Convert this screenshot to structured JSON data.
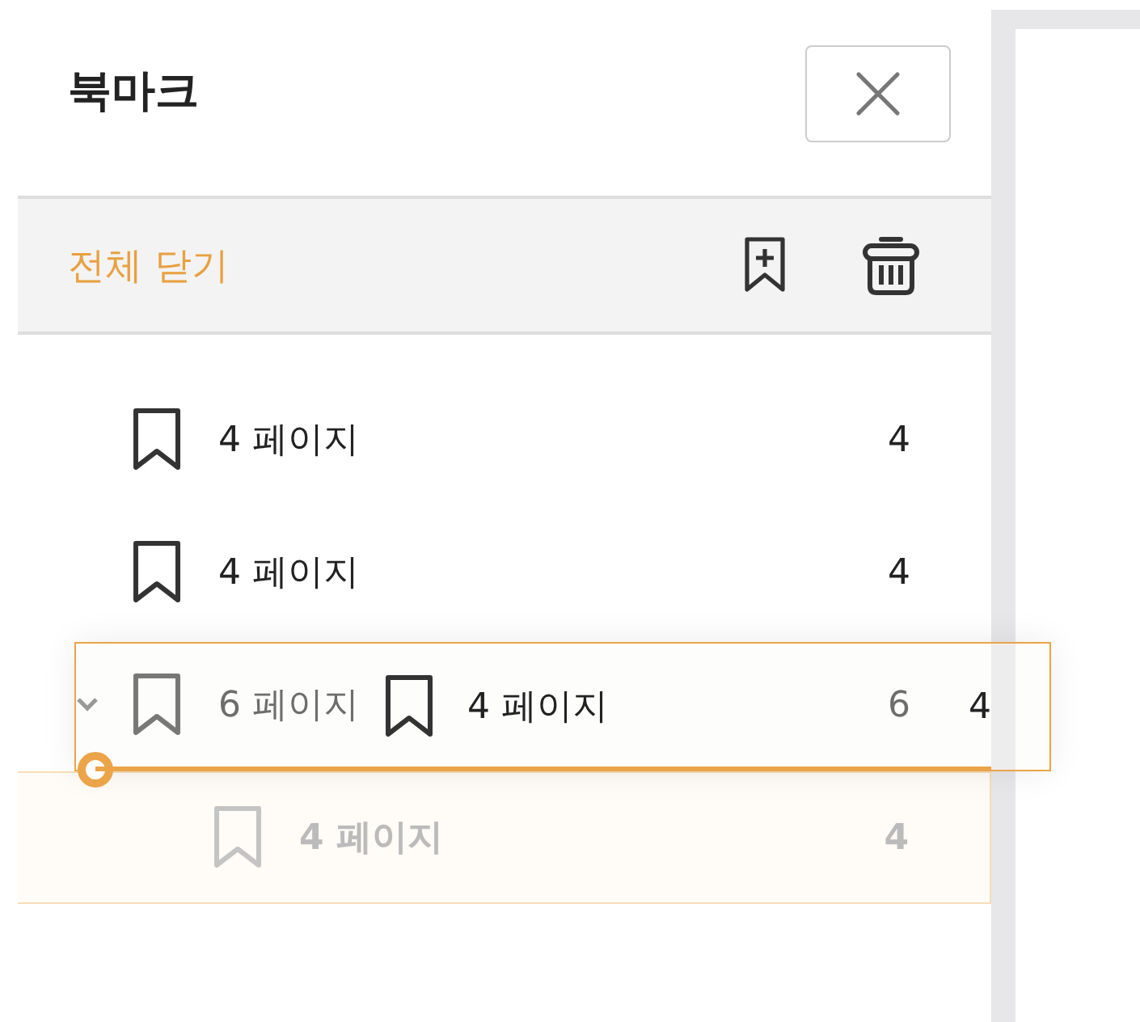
{
  "panel": {
    "title": "북마크"
  },
  "toolbar": {
    "collapse_all": "전체 닫기"
  },
  "bookmarks": [
    {
      "label": "4 페이지",
      "page": "4",
      "dragging": false
    },
    {
      "label": "4 페이지",
      "page": "4",
      "dragging": false
    },
    {
      "label": "6 페이지",
      "page": "6",
      "expanded": true,
      "dragging": false,
      "children": [
        {
          "label": "4 페이지",
          "page": "4",
          "dragging": true
        }
      ]
    }
  ],
  "drag_ghost": {
    "label": "4 페이지",
    "page": "4"
  }
}
